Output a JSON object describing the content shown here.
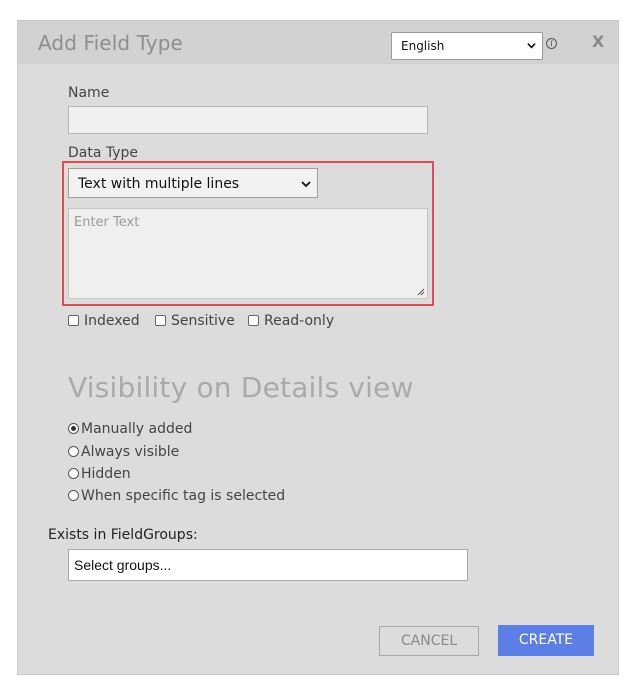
{
  "dialog": {
    "title": "Add Field Type",
    "language_selected": "English",
    "info_icon": "info-icon",
    "close_label": "X"
  },
  "form": {
    "name_label": "Name",
    "name_value": "",
    "data_type_label": "Data Type",
    "data_type_selected": "Text with multiple lines",
    "text_placeholder": "Enter Text",
    "checkboxes": [
      {
        "label": "Indexed",
        "checked": false
      },
      {
        "label": "Sensitive",
        "checked": false
      },
      {
        "label": "Read-only",
        "checked": false
      }
    ]
  },
  "visibility": {
    "heading": "Visibility on Details view",
    "options": [
      {
        "label": "Manually added",
        "checked": true
      },
      {
        "label": "Always visible",
        "checked": false
      },
      {
        "label": "Hidden",
        "checked": false
      },
      {
        "label": "When specific tag is selected",
        "checked": false
      }
    ]
  },
  "field_groups": {
    "label": "Exists in FieldGroups:",
    "placeholder": "Select groups..."
  },
  "actions": {
    "cancel_label": "CANCEL",
    "create_label": "CREATE"
  },
  "colors": {
    "dialog_bg": "#dcdcdc",
    "highlight_border": "#e14d4d",
    "create_button": "#5b7fe6"
  }
}
